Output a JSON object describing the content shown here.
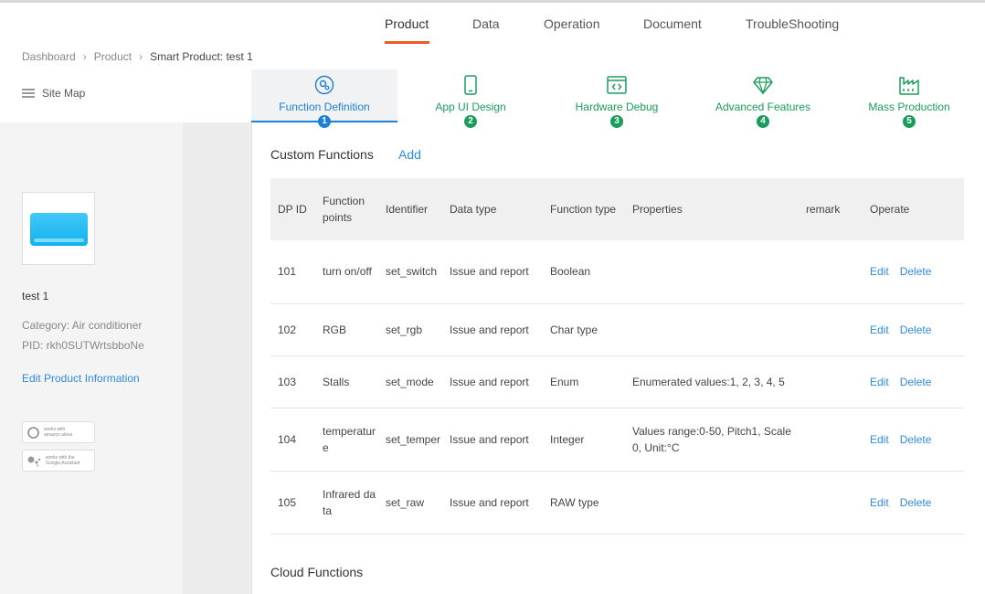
{
  "topnav": {
    "items": [
      "Product",
      "Data",
      "Operation",
      "Document",
      "TroubleShooting"
    ],
    "active": "Product",
    "accent": "#f05a22"
  },
  "breadcrumb": [
    "Dashboard",
    "Product",
    "Smart Product: test 1"
  ],
  "sitemap_label": "Site Map",
  "tabs": [
    {
      "label": "Function Definition",
      "num": "1",
      "icon": "gear-icon",
      "active": true
    },
    {
      "label": "App UI Design",
      "num": "2",
      "icon": "phone-icon"
    },
    {
      "label": "Hardware Debug",
      "num": "3",
      "icon": "code-window-icon"
    },
    {
      "label": "Advanced Features",
      "num": "4",
      "icon": "diamond-icon"
    },
    {
      "label": "Mass Production",
      "num": "5",
      "icon": "factory-icon"
    }
  ],
  "colors": {
    "active_blue": "#1e7fd6",
    "step_green": "#1a9d5c",
    "link_blue": "#2f8ae0"
  },
  "product": {
    "name": "test 1",
    "category": "Category: Air conditioner",
    "pid": "PID: rkh0SUTWrtsbboNe",
    "edit_label": "Edit Product Information",
    "badges": [
      {
        "icon": "alexa-icon",
        "line1": "works with",
        "line2": "amazon alexa"
      },
      {
        "icon": "google-assistant-icon",
        "line1": "works with the",
        "line2": "Google Assistant"
      }
    ]
  },
  "custom": {
    "title": "Custom Functions",
    "add_label": "Add",
    "columns": [
      "DP ID",
      "Function points",
      "Identifier",
      "Data type",
      "Function type",
      "Properties",
      "remark",
      "Operate"
    ],
    "rows": [
      {
        "id": "101",
        "point": "turn on/off",
        "ident": "set_switch",
        "dtype": "Issue and report",
        "ftype": "Boolean",
        "props": "",
        "remark": "",
        "edit": "Edit",
        "del": "Delete"
      },
      {
        "id": "102",
        "point": "RGB",
        "ident": "set_rgb",
        "dtype": "Issue and report",
        "ftype": "Char type",
        "props": "",
        "remark": "",
        "edit": "Edit",
        "del": "Delete"
      },
      {
        "id": "103",
        "point": "Stalls",
        "ident": "set_mode",
        "dtype": "Issue and report",
        "ftype": "Enum",
        "props": "Enumerated values:1, 2, 3, 4, 5",
        "remark": "",
        "edit": "Edit",
        "del": "Delete"
      },
      {
        "id": "104",
        "point": "temperature",
        "ident": "set_temper",
        "dtype": "Issue and report",
        "ftype": "Integer",
        "props": "Values range:0-50, Pitch1, Scale 0, Unit:°C",
        "remark": "",
        "edit": "Edit",
        "del": "Delete"
      },
      {
        "id": "105",
        "point": "Infrared data",
        "ident": "set_raw",
        "dtype": "Issue and report",
        "ftype": "RAW type",
        "props": "",
        "remark": "",
        "edit": "Edit",
        "del": "Delete"
      }
    ]
  },
  "cloud": {
    "title": "Cloud Functions"
  }
}
